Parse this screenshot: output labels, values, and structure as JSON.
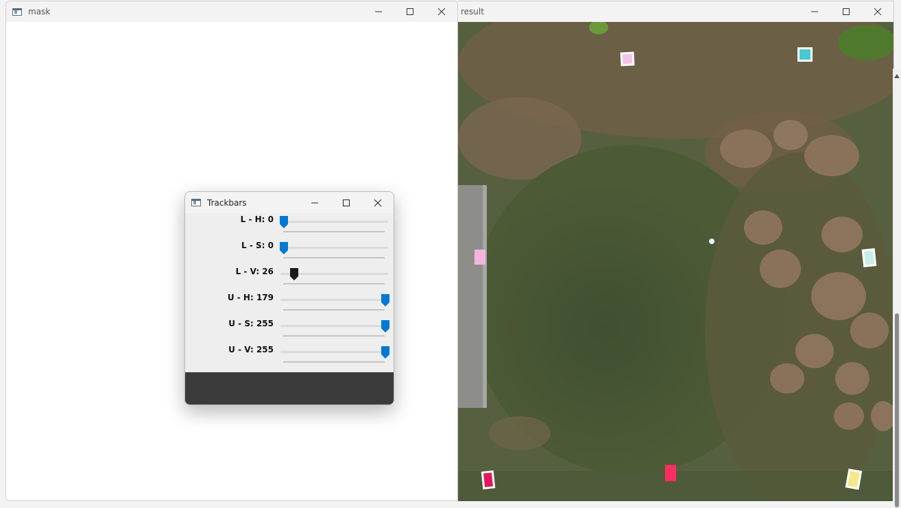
{
  "windows": {
    "mask": {
      "title": "mask"
    },
    "result": {
      "title": "result"
    },
    "trackbars": {
      "title": "Trackbars",
      "sliders": [
        {
          "label": "L - H: 0",
          "value": 0,
          "max": 179,
          "accent": "#0078d4"
        },
        {
          "label": "L - S: 0",
          "value": 0,
          "max": 255,
          "accent": "#0078d4"
        },
        {
          "label": "L - V: 26",
          "value": 26,
          "max": 255,
          "accent": "#1a1a1a"
        },
        {
          "label": "U - H: 179",
          "value": 179,
          "max": 179,
          "accent": "#0078d4"
        },
        {
          "label": "U - S: 255",
          "value": 255,
          "max": 255,
          "accent": "#0078d4"
        },
        {
          "label": "U - V: 255",
          "value": 255,
          "max": 255,
          "accent": "#0078d4"
        }
      ]
    }
  },
  "icons": {
    "minimize": "minimize-icon",
    "maximize": "maximize-icon",
    "close": "close-icon",
    "app": "app-window-icon"
  },
  "colors": {
    "slider_accent": "#0078d4",
    "slider_focused": "#1a1a1a",
    "grass": "#4a5a32",
    "dirt": "#7a6650"
  }
}
